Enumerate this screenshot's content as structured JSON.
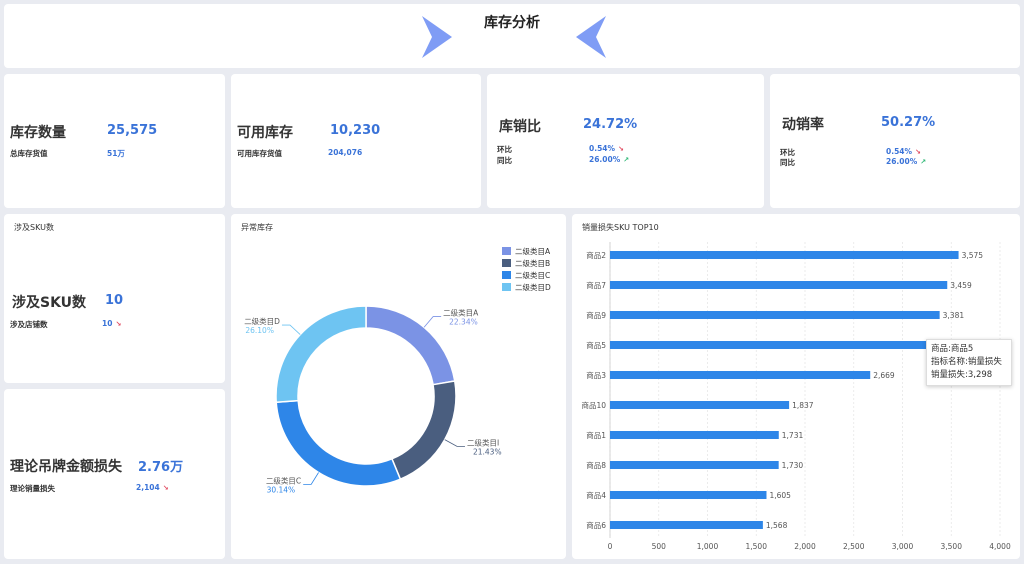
{
  "header": {
    "title": "库存分析"
  },
  "kpis": {
    "stock": {
      "label": "库存数量",
      "value": "25,575",
      "sub_label": "总库存货值",
      "sub_value": "51万"
    },
    "available": {
      "label": "可用库存",
      "value": "10,230",
      "sub_label": "可用库存货值",
      "sub_value": "204,076"
    },
    "sell_ratio": {
      "label": "库销比",
      "value": "24.72%",
      "hb_label": "环比",
      "hb_value": "0.54%",
      "tb_label": "同比",
      "tb_value": "26.00%"
    },
    "sell_through": {
      "label": "动销率",
      "value": "50.27%",
      "hb_label": "环比",
      "hb_value": "0.54%",
      "tb_label": "同比",
      "tb_value": "26.00%"
    }
  },
  "sku_card": {
    "title": "涉及SKU数",
    "label": "涉及SKU数",
    "value": "10",
    "sub_label": "涉及店铺数",
    "sub_value": "10"
  },
  "loss_card": {
    "label": "理论吊牌金额损失",
    "value": "2.76万",
    "sub_label": "理论销量损失",
    "sub_value": "2,104"
  },
  "icons": {
    "down": "trend-down-icon",
    "up": "trend-up-icon"
  },
  "colors": {
    "accent": "#3a73d8",
    "bar": "#2e86e8",
    "down": "#e0455b",
    "up": "#2bb673",
    "arrow": "#7f9cf5"
  },
  "chart_data": [
    {
      "type": "pie",
      "title": "异常库存",
      "donut": true,
      "categories": [
        "二级类目A",
        "二级类目B",
        "二级类目C",
        "二级类目D"
      ],
      "values": [
        22.34,
        21.43,
        30.14,
        26.1
      ],
      "value_labels": [
        "22.34%",
        "21.43%",
        "30.14%",
        "26.10%"
      ],
      "slice_labels": [
        "二级类目A",
        "二级类目I",
        "二级类目C",
        "二级类目D"
      ],
      "colors": [
        "#7b93e5",
        "#4a5e7f",
        "#2e86e8",
        "#6ec4f2"
      ],
      "legend": "top-right"
    },
    {
      "type": "bar",
      "orientation": "horizontal",
      "title": "销量损失SKU TOP10",
      "categories": [
        "商品2",
        "商品7",
        "商品9",
        "商品5",
        "商品3",
        "商品10",
        "商品1",
        "商品8",
        "商品4",
        "商品6"
      ],
      "values": [
        3575,
        3459,
        3381,
        3298,
        2669,
        1837,
        1731,
        1730,
        1605,
        1568
      ],
      "value_labels": [
        "3,575",
        "3,459",
        "3,381",
        "",
        "2,669",
        "1,837",
        "1,731",
        "1,730",
        "1,605",
        "1,568"
      ],
      "xlim": [
        0,
        4000
      ],
      "xticks": [
        "0",
        "500",
        "1,000",
        "1,500",
        "2,000",
        "2,500",
        "3,000",
        "3,500",
        "4,000"
      ],
      "grid": true,
      "tooltip": [
        "商品:商品5",
        "指标名称:销量损失",
        "销量损失:3,298"
      ]
    }
  ]
}
